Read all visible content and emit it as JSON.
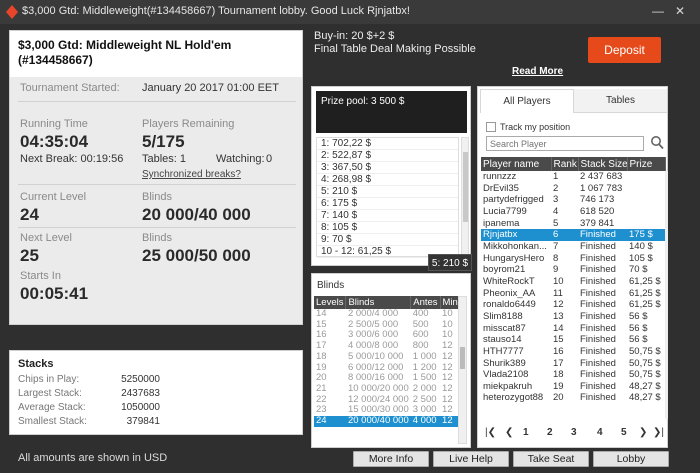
{
  "window": {
    "title": "$3,000 Gtd: Middleweight(#134458667) Tournament lobby. Good Luck Rjnjatbx!"
  },
  "tournament": {
    "name_line1": "$3,000 Gtd: Middleweight NL Hold'em",
    "name_line2": "(#134458667)",
    "started_label": "Tournament Started:",
    "started_value": "January 20 2017   01:00 EET",
    "running_time_label": "Running Time",
    "running_time_value": "04:35:04",
    "next_break_label": "Next Break: 00:19:56",
    "players_remaining_label": "Players Remaining",
    "players_remaining_value": "5/175",
    "tables_label": "Tables: 1",
    "watching_label": "Watching:",
    "watching_value": "0",
    "sync_breaks_link": "Synchronized breaks?",
    "current_level_label": "Current Level",
    "current_level_value": "24",
    "blinds_label": "Blinds",
    "current_blinds_value": "20 000/40 000",
    "next_level_label": "Next Level",
    "next_level_value": "25",
    "next_blinds_value": "25 000/50 000",
    "starts_in_label": "Starts In",
    "starts_in_value": "00:05:41"
  },
  "stacks": {
    "title": "Stacks",
    "rows": [
      {
        "label": "Chips in Play:",
        "value": "5250000"
      },
      {
        "label": "Largest Stack:",
        "value": "2437683"
      },
      {
        "label": "Average Stack:",
        "value": "1050000"
      },
      {
        "label": "Smallest Stack:",
        "value": "379841"
      }
    ]
  },
  "footnote": "All amounts are shown in USD",
  "buyin": {
    "line1": "Buy-in: 20 $+2 $",
    "line2": "Final Table Deal Making Possible",
    "deposit_label": "Deposit",
    "read_more": "Read More"
  },
  "prize_pool": {
    "title": "Prize pool: 3 500 $",
    "places": [
      "1: 702,22 $",
      "2: 522,87 $",
      "3: 367,50 $",
      "4: 268,98 $",
      "5: 210 $",
      "6: 175 $",
      "7: 140 $",
      "8: 105 $",
      "9: 70 $",
      "10 - 12: 61,25 $"
    ],
    "tooltip": "5: 210 $"
  },
  "blinds": {
    "title": "Blinds",
    "headers": [
      "Levels",
      "Blinds",
      "Antes",
      "Min."
    ],
    "rows": [
      [
        "14",
        "2 000/4 000",
        "400",
        "10"
      ],
      [
        "15",
        "2 500/5 000",
        "500",
        "10"
      ],
      [
        "16",
        "3 000/6 000",
        "600",
        "10"
      ],
      [
        "17",
        "4 000/8 000",
        "800",
        "12"
      ],
      [
        "18",
        "5 000/10 000",
        "1 000",
        "12"
      ],
      [
        "19",
        "6 000/12 000",
        "1 200",
        "12"
      ],
      [
        "20",
        "8 000/16 000",
        "1 500",
        "12"
      ],
      [
        "21",
        "10 000/20 000",
        "2 000",
        "12"
      ],
      [
        "22",
        "12 000/24 000",
        "2 500",
        "12"
      ],
      [
        "23",
        "15 000/30 000",
        "3 000",
        "12"
      ],
      [
        "24",
        "20 000/40 000",
        "4 000",
        "12"
      ]
    ],
    "selected_index": 10
  },
  "players": {
    "tab_all": "All Players",
    "tab_tables": "Tables",
    "track_label": "Track my position",
    "search_placeholder": "Search Player",
    "headers": [
      "Player name",
      "Rank",
      "Stack Size",
      "Prize"
    ],
    "rows": [
      [
        "runnzzz",
        "1",
        "2 437 683",
        ""
      ],
      [
        "DrEvil35",
        "2",
        "1 067 783",
        ""
      ],
      [
        "partydefrigged",
        "3",
        "746 173",
        ""
      ],
      [
        "Lucia7799",
        "4",
        "618 520",
        ""
      ],
      [
        "ipanema",
        "5",
        "379 841",
        ""
      ],
      [
        "Rjnjatbx",
        "6",
        "Finished",
        "175 $"
      ],
      [
        "Mikkohonkan...",
        "7",
        "Finished",
        "140 $"
      ],
      [
        "HungarysHero",
        "8",
        "Finished",
        "105 $"
      ],
      [
        "boyrom21",
        "9",
        "Finished",
        "70 $"
      ],
      [
        "WhiteRockT",
        "10",
        "Finished",
        "61,25 $"
      ],
      [
        "Pheonix_AA",
        "11",
        "Finished",
        "61,25 $"
      ],
      [
        "ronaldo6449",
        "12",
        "Finished",
        "61,25 $"
      ],
      [
        "Slim8188",
        "13",
        "Finished",
        "56 $"
      ],
      [
        "misscat87",
        "14",
        "Finished",
        "56 $"
      ],
      [
        "stauso14",
        "15",
        "Finished",
        "56 $"
      ],
      [
        "HTH7777",
        "16",
        "Finished",
        "50,75 $"
      ],
      [
        "Shurik389",
        "17",
        "Finished",
        "50,75 $"
      ],
      [
        "Vlada2108",
        "18",
        "Finished",
        "50,75 $"
      ],
      [
        "miekpakruh",
        "19",
        "Finished",
        "48,27 $"
      ],
      [
        "heterozygot88",
        "20",
        "Finished",
        "48,27 $"
      ]
    ],
    "selected_index": 5,
    "pages": [
      "1",
      "2",
      "3",
      "4",
      "5"
    ],
    "current_page": "1"
  },
  "buttons": {
    "more_info": "More Info",
    "live_help": "Live Help",
    "take_seat": "Take Seat",
    "lobby": "Lobby"
  },
  "colors": {
    "accent": "#1e90d0",
    "deposit": "#e64a1a",
    "background": "#2f2f2f"
  }
}
